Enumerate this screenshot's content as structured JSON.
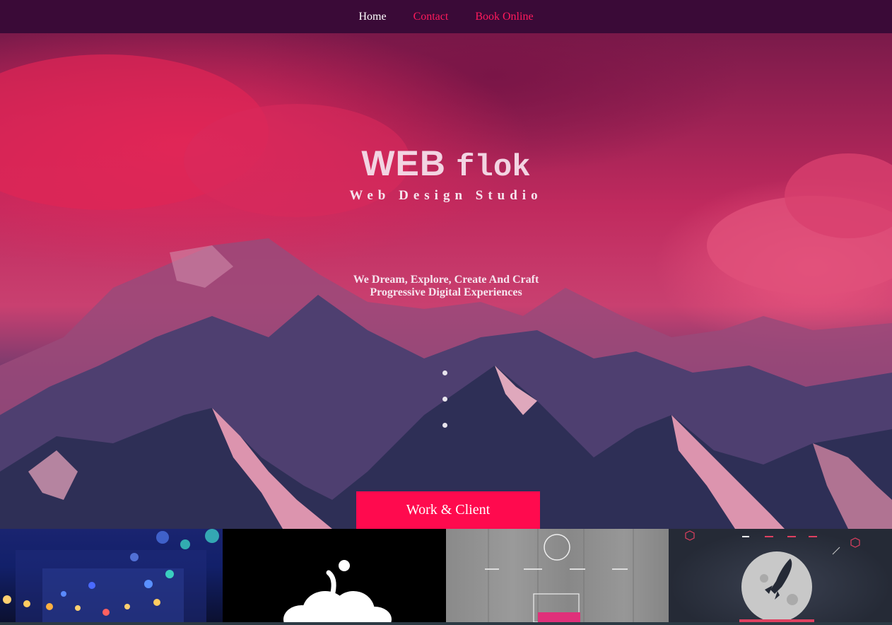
{
  "nav": {
    "items": [
      {
        "label": "Home"
      },
      {
        "label": "Contact"
      },
      {
        "label": "Book Online"
      }
    ]
  },
  "hero": {
    "brand_bold": "WEB",
    "brand_mono": "flok",
    "tagline": "Web Design Studio",
    "intro_line1": "We Dream, Explore, Create And Craft",
    "intro_line2": "Progressive Digital Experiences",
    "cta_label": "Work & Client"
  },
  "colors": {
    "nav_bg": "#3a0a37",
    "nav_accent": "#ff1a5c",
    "cta_bg": "#ff0a4e"
  },
  "gallery": {
    "tile_count": 4
  }
}
